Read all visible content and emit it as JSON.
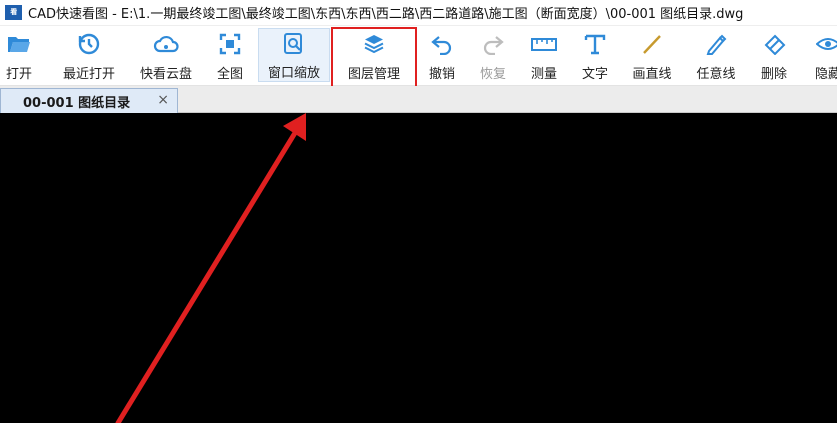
{
  "window": {
    "app_icon": "CAD-app-icon",
    "title": "CAD快速看图 - E:\\1.一期最终竣工图\\最终竣工图\\东西\\东西\\西二路\\西二路道路\\施工图（断面宽度）\\00-001 图纸目录.dwg"
  },
  "toolbar": {
    "open": "打开",
    "recent": "最近打开",
    "cloud": "快看云盘",
    "full": "全图",
    "zoom_window": "窗口缩放",
    "layers": "图层管理",
    "undo": "撤销",
    "redo": "恢复",
    "measure": "测量",
    "text": "文字",
    "line": "画直线",
    "freeline": "任意线",
    "delete": "删除",
    "hide": "隐藏"
  },
  "tabs": {
    "doc_label": "00-001  图纸目录",
    "close_glyph": "×"
  },
  "colors": {
    "accent": "#2f8ad8",
    "highlight": "#e02020",
    "canvas": "#000000"
  }
}
